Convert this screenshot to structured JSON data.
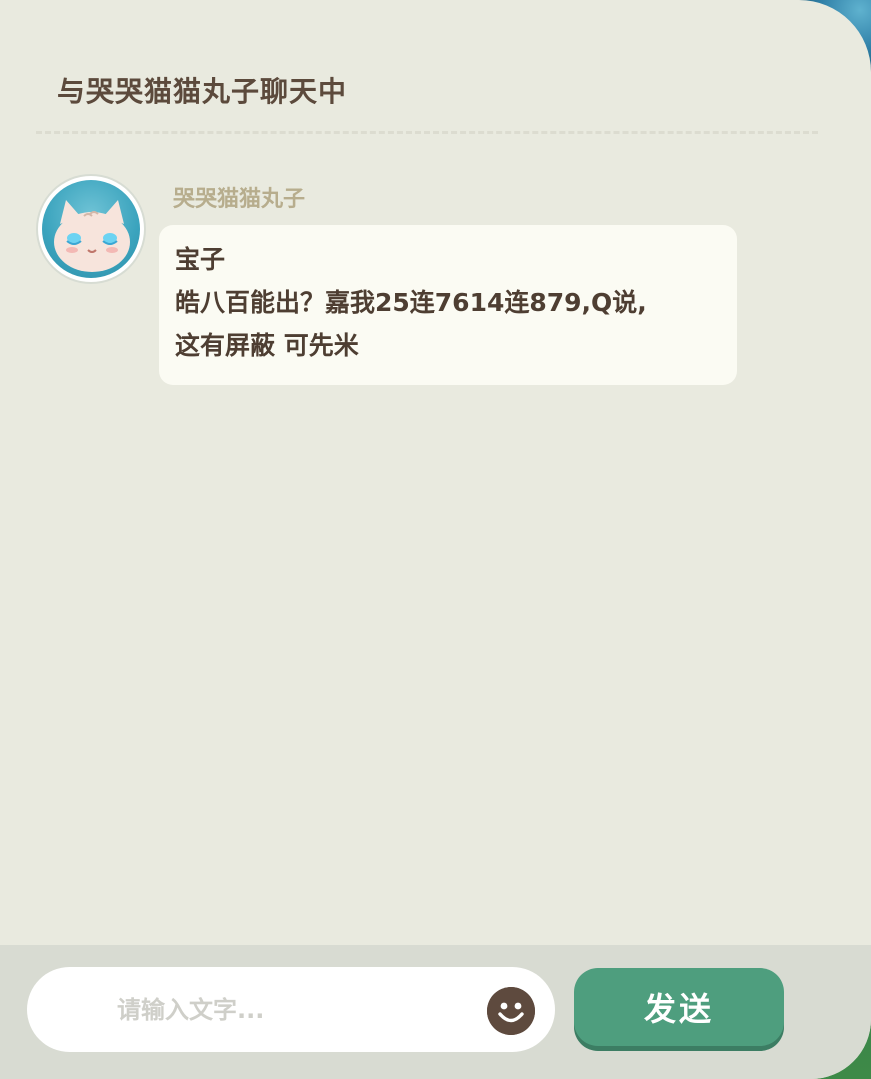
{
  "header": {
    "title": "与哭哭猫猫丸子聊天中"
  },
  "message": {
    "sender": "哭哭猫猫丸子",
    "avatar_icon": "crying-cat-avatar",
    "lines": [
      "宝子",
      "皓八百能出？嘉我25连7614连879,Q说,",
      "这有屏蔽 可先米"
    ]
  },
  "composer": {
    "placeholder": "请输入文字...",
    "emoji_icon": "smiley-icon",
    "send_label": "发送"
  },
  "colors": {
    "panel_bg": "#e9eadf",
    "bubble_bg": "#fbfbf3",
    "text_dark": "#4e3e32",
    "name_text": "#b7ad8d",
    "send_button": "#4e9e7e"
  }
}
